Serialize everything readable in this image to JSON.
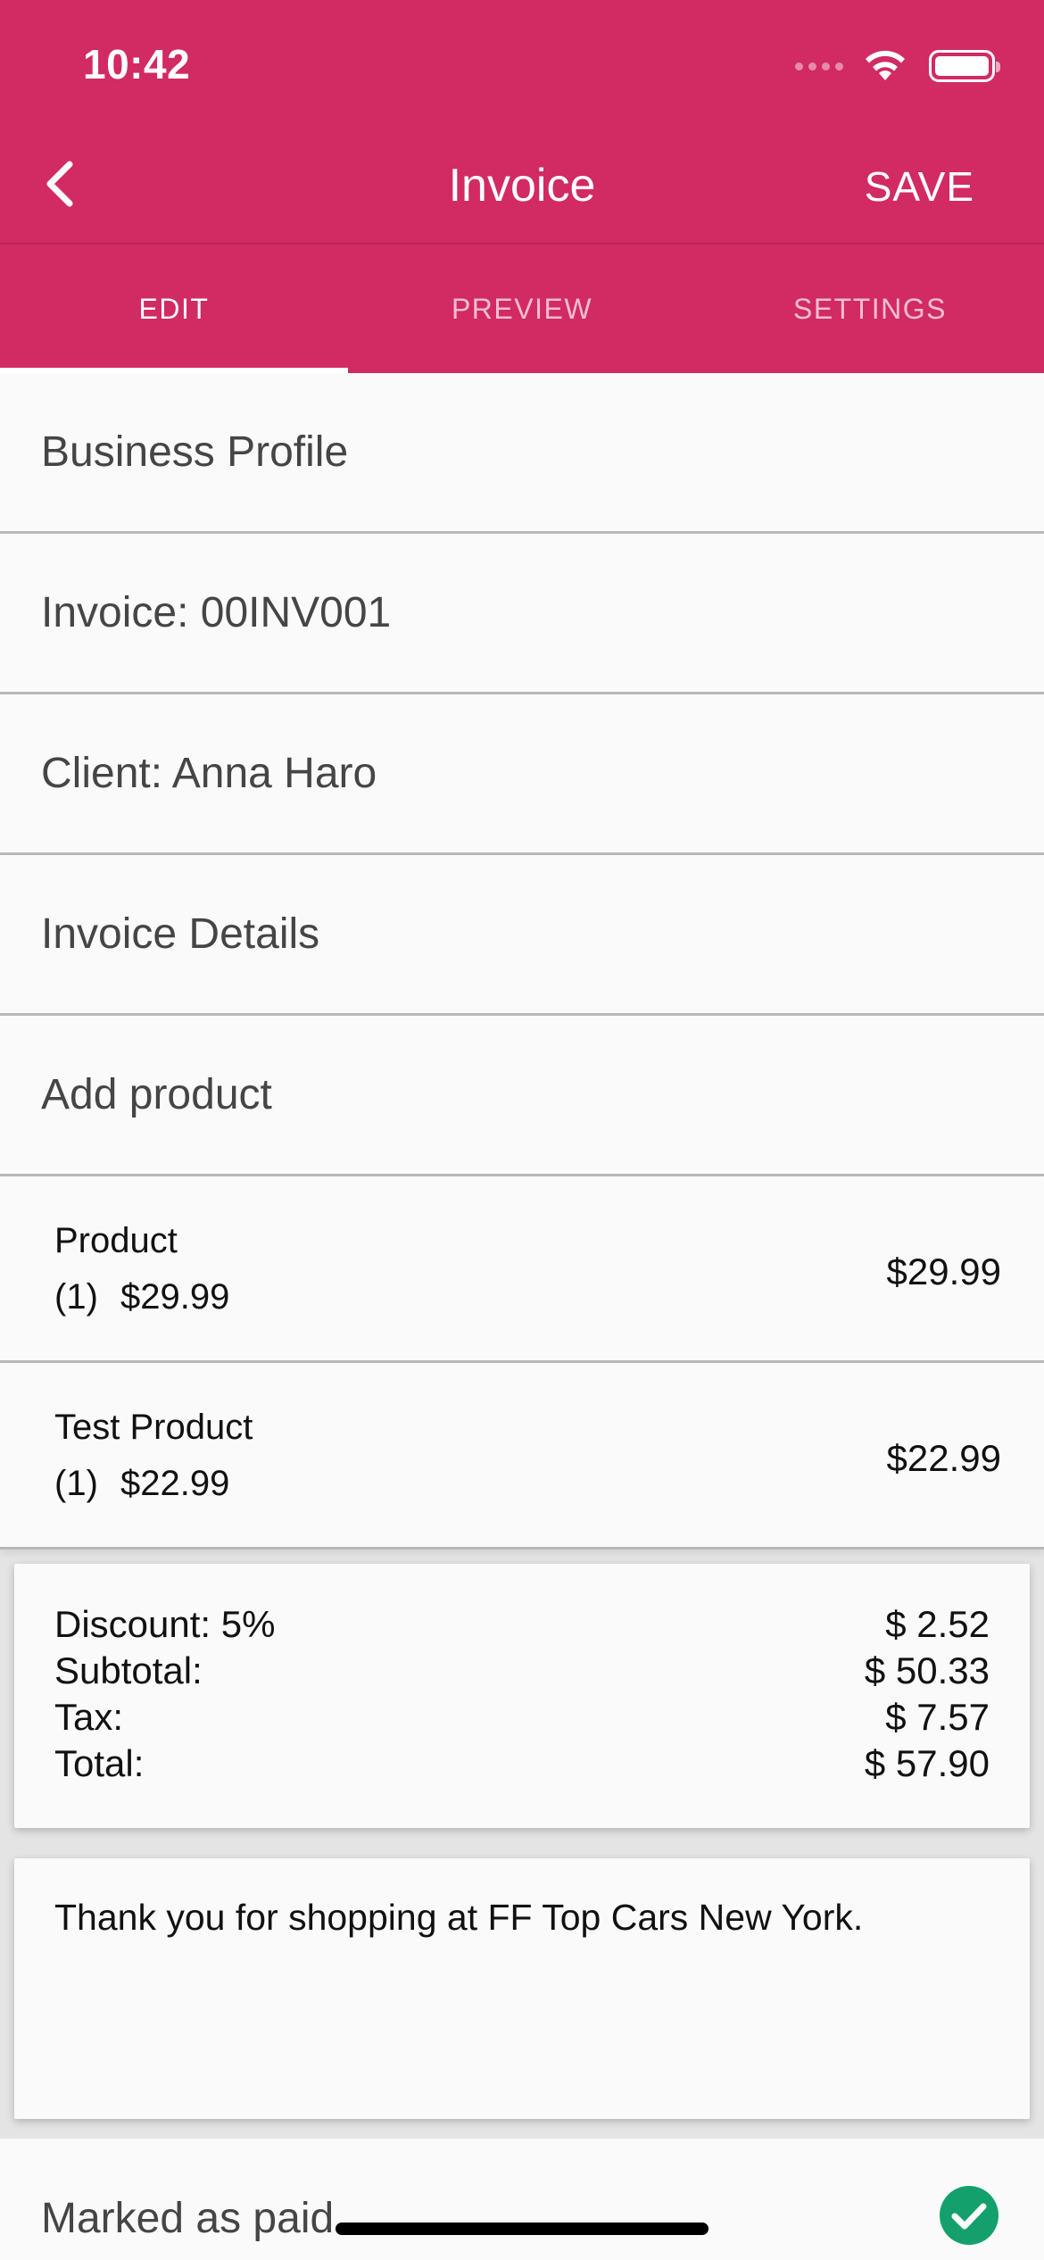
{
  "status_bar": {
    "time": "10:42"
  },
  "header": {
    "title": "Invoice",
    "save_label": "SAVE"
  },
  "tabs": [
    {
      "label": "EDIT",
      "active": true
    },
    {
      "label": "PREVIEW",
      "active": false
    },
    {
      "label": "SETTINGS",
      "active": false
    }
  ],
  "sections": {
    "business_profile": "Business Profile",
    "invoice": "Invoice: 00INV001",
    "client": "Client: Anna Haro",
    "invoice_details": "Invoice Details",
    "add_product": "Add product"
  },
  "products": [
    {
      "name": "Product",
      "qty": "(1)",
      "unit_price": "$29.99",
      "total": "$29.99"
    },
    {
      "name": "Test Product",
      "qty": "(1)",
      "unit_price": "$22.99",
      "total": "$22.99"
    }
  ],
  "summary": {
    "discount_label": "Discount: 5%",
    "discount_value": "$ 2.52",
    "subtotal_label": "Subtotal:",
    "subtotal_value": "$ 50.33",
    "tax_label": "Tax:",
    "tax_value": "$ 7.57",
    "total_label": "Total:",
    "total_value": "$ 57.90"
  },
  "note": "Thank you for shopping at FF Top Cars New York.",
  "paid": {
    "label": "Marked as paid",
    "checked": true
  },
  "colors": {
    "accent": "#d22a62",
    "check": "#14a06c"
  }
}
